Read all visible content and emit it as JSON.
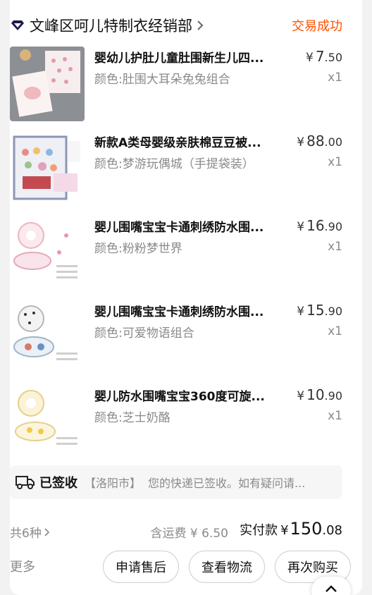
{
  "shop": {
    "name": "文峰区呵儿特制衣经销部",
    "status": "交易成功",
    "icon": "shop-diamond-icon",
    "accent": "#ff5000"
  },
  "items": [
    {
      "title": "婴幼儿护肚儿童肚围新生儿四...",
      "spec": "颜色:肚围大耳朵兔兔组合",
      "price_currency": "¥",
      "price_int": "7",
      "price_dec": ".50",
      "qty": "x1"
    },
    {
      "title": "新款A类母婴级亲肤棉豆豆被...",
      "spec": "颜色:梦游玩偶城（手提袋装）",
      "price_currency": "¥",
      "price_int": "88",
      "price_dec": ".00",
      "qty": "x1"
    },
    {
      "title": "婴儿围嘴宝宝卡通刺绣防水围...",
      "spec": "颜色:粉粉梦世界",
      "price_currency": "¥",
      "price_int": "16",
      "price_dec": ".90",
      "qty": "x1"
    },
    {
      "title": "婴儿围嘴宝宝卡通刺绣防水围...",
      "spec": "颜色:可爱物语组合",
      "price_currency": "¥",
      "price_int": "15",
      "price_dec": ".90",
      "qty": "x1"
    },
    {
      "title": "婴儿防水围嘴宝宝360度可旋...",
      "spec": "颜色:芝士奶酪",
      "price_currency": "¥",
      "price_int": "10",
      "price_dec": ".90",
      "qty": "x1"
    }
  ],
  "logistics": {
    "status": "已签收",
    "city": "【洛阳市】",
    "message": "您的快递已签收。如有疑问请..."
  },
  "summary": {
    "count": "共6种",
    "shipping": "含运费 ¥ 6.50",
    "paid_label": "实付款",
    "paid_currency": "¥",
    "paid_int": "150",
    "paid_dec": ".08"
  },
  "actions": {
    "more": "更多",
    "after_sale": "申请售后",
    "view_logistics": "查看物流",
    "buy_again": "再次购买"
  }
}
